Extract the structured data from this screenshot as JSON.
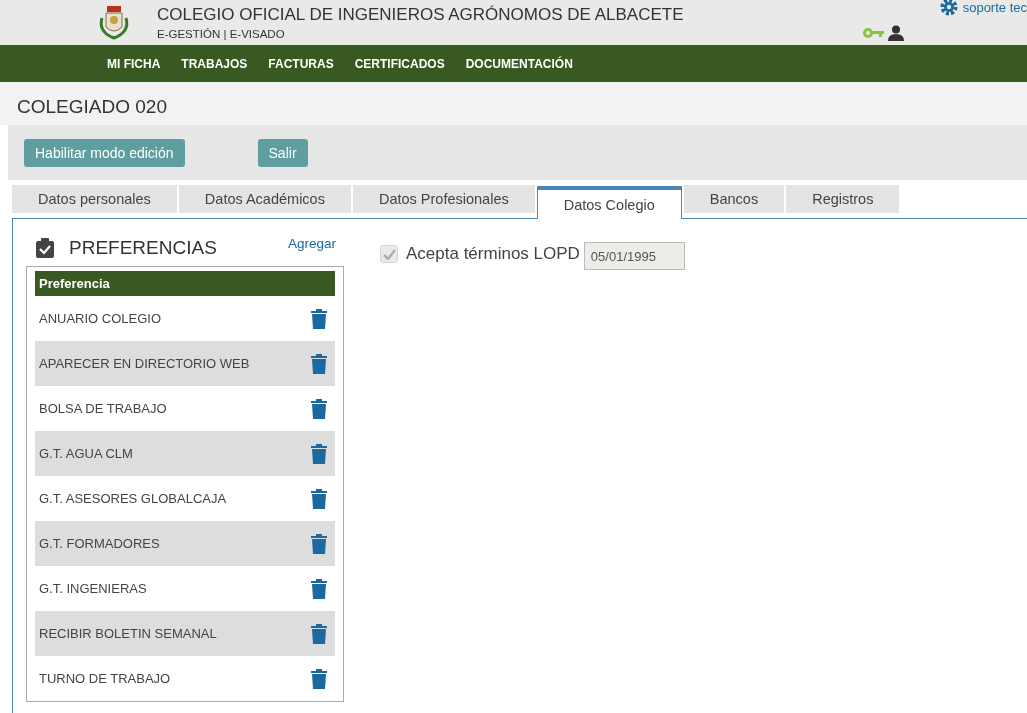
{
  "header": {
    "title": "COLEGIO OFICIAL DE INGENIEROS AGRÓNOMOS DE ALBACETE",
    "subtitle": "E-GESTIÓN | E-VISADO",
    "support_link": "soporte tec"
  },
  "nav": [
    "MI FICHA",
    "TRABAJOS",
    "FACTURAS",
    "CERTIFICADOS",
    "DOCUMENTACIÓN"
  ],
  "page_title": "COLEGIADO 020",
  "buttons": [
    "Habilitar modo edición",
    "Salir"
  ],
  "tabs": [
    {
      "label": "Datos personales",
      "selected": false
    },
    {
      "label": "Datos Académicos",
      "selected": false
    },
    {
      "label": "Datos Profesionales",
      "selected": false
    },
    {
      "label": "Datos Colegio",
      "selected": true
    },
    {
      "label": "Bancos",
      "selected": false
    },
    {
      "label": "Registros",
      "selected": false
    }
  ],
  "preferences": {
    "title": "PREFERENCIAS",
    "add_link": "Agregar",
    "column": "Preferencia",
    "rows": [
      {
        "name": "ANUARIO COLEGIO"
      },
      {
        "name": "APARECER EN DIRECTORIO WEB"
      },
      {
        "name": "BOLSA DE TRABAJO"
      },
      {
        "name": "G.T. AGUA CLM"
      },
      {
        "name": "G.T. ASESORES GLOBALCAJA"
      },
      {
        "name": "G.T. FORMADORES"
      },
      {
        "name": "G.T. INGENIERAS"
      },
      {
        "name": "RECIBIR BOLETIN SEMANAL"
      },
      {
        "name": "TURNO DE TRABAJO"
      }
    ]
  },
  "lopd": {
    "label": "Acepta términos LOPD",
    "checked": true,
    "disabled": true,
    "date": "05/01/1995"
  }
}
